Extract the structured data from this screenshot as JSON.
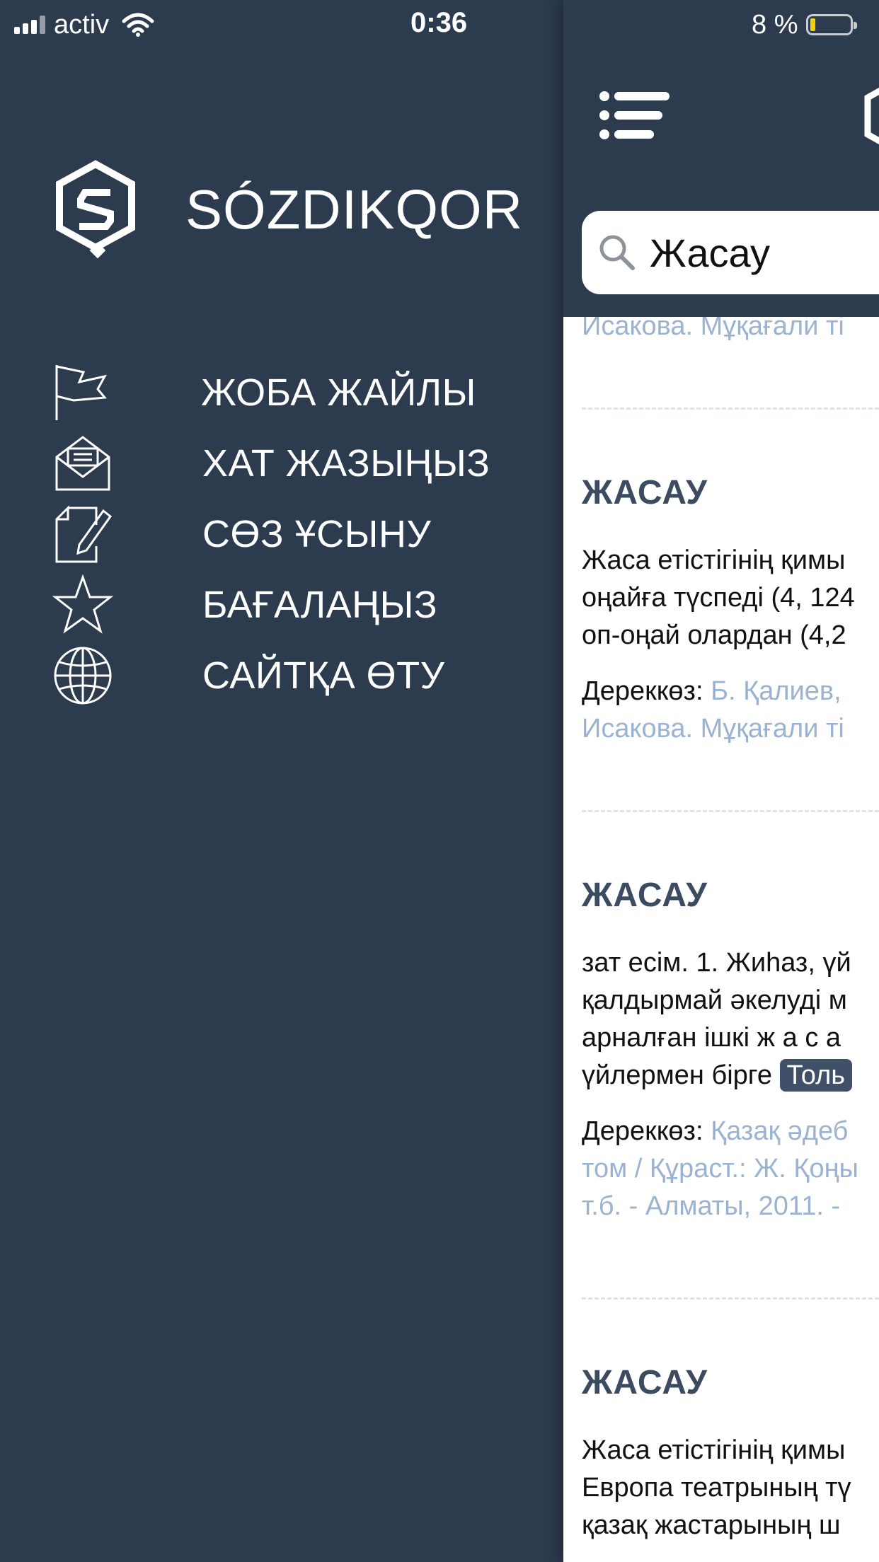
{
  "status_bar": {
    "carrier": "activ",
    "time": "0:36",
    "battery": "8 %",
    "battery_level": 0.08
  },
  "colors": {
    "sidebar_bg": "#2d3b4e",
    "link": "#9bb3d1",
    "title": "#3d4b60",
    "battery_low": "#f4cf0b"
  },
  "sidebar": {
    "brand": "SÓZDIKQOR",
    "items": [
      {
        "label": "ЖОБА ЖАЙЛЫ",
        "icon": "flag-icon"
      },
      {
        "label": "ХАТ ЖАЗЫҢЫЗ",
        "icon": "envelope-icon"
      },
      {
        "label": "СӨЗ ҰСЫНУ",
        "icon": "edit-document-icon"
      },
      {
        "label": "БАҒАЛАҢЫЗ",
        "icon": "star-icon"
      },
      {
        "label": "САЙТҚА ӨТУ",
        "icon": "globe-icon"
      }
    ]
  },
  "search": {
    "value": "Жасау"
  },
  "results": {
    "top_ref": "Исакова. Мұқағали ті",
    "entries": [
      {
        "title": "ЖАСАУ",
        "lines": [
          "Жаса етістігінің қимы",
          "оңайға түспеді (4, 124",
          "оп-оңай олардан (4,2"
        ],
        "source_label": "Дереккөз:",
        "source_lines": [
          "Б. Қалиев,",
          "Исакова. Мұқағали ті"
        ]
      },
      {
        "title": "ЖАСАУ",
        "lines": [
          "зат есім. 1. Жиһаз, үй",
          "қалдырмай әкелуді м",
          "арналған ішкі ж а с а"
        ],
        "last_line": "үйлермен бірге",
        "tag": "Толь",
        "source_label": "Дереккөз:",
        "source_lines": [
          "Қазақ әдеб",
          "том / Құраст.: Ж. Қоңы",
          "т.б. - Алматы, 2011. -"
        ]
      },
      {
        "title": "ЖАСАУ",
        "lines": [
          "Жаса етістігінің қимы",
          "Европа театрының тү",
          "қазақ жастарының ш"
        ]
      }
    ]
  }
}
